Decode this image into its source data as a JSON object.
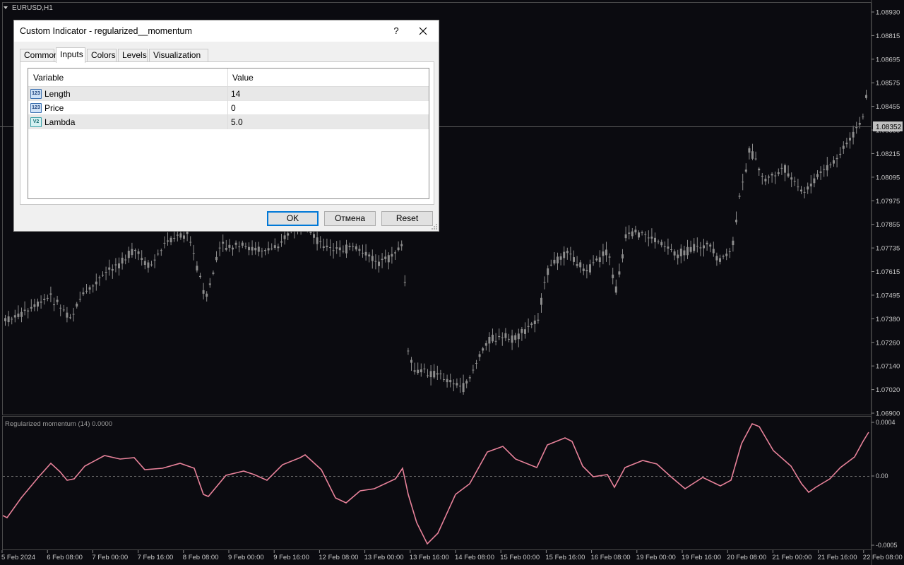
{
  "chart": {
    "symbol": "EURUSD,H1",
    "price_scale": [
      "1.08930",
      "1.08815",
      "1.08695",
      "1.08575",
      "1.08455",
      "1.08335",
      "1.08215",
      "1.08095",
      "1.07975",
      "1.07855",
      "1.07735",
      "1.07615",
      "1.07495",
      "1.07380",
      "1.07260",
      "1.07140",
      "1.07020",
      "1.06900"
    ],
    "current_price": "1.08352",
    "colors": {
      "background": "#0b0b10",
      "candles": "#8c8c8c",
      "indicator_line": "#e8829a",
      "price_tag": "#c0c0c0"
    }
  },
  "indicator": {
    "label": "Regularized momentum (14) 0.0000",
    "scale": [
      "0.0004",
      "0.00",
      "-0.0005"
    ],
    "levels": [
      0.0004,
      0.0,
      -0.0005
    ]
  },
  "time_axis": [
    "5 Feb 2024",
    "6 Feb 08:00",
    "7 Feb 00:00",
    "7 Feb 16:00",
    "8 Feb 08:00",
    "9 Feb 00:00",
    "9 Feb 16:00",
    "12 Feb 08:00",
    "13 Feb 00:00",
    "13 Feb 16:00",
    "14 Feb 08:00",
    "15 Feb 00:00",
    "15 Feb 16:00",
    "16 Feb 08:00",
    "19 Feb 00:00",
    "19 Feb 16:00",
    "20 Feb 08:00",
    "21 Feb 00:00",
    "21 Feb 16:00",
    "22 Feb 08:00"
  ],
  "dialog": {
    "title": "Custom Indicator - regularized__momentum",
    "help": "?",
    "tabs": [
      "Common",
      "Inputs",
      "Colors",
      "Levels",
      "Visualization"
    ],
    "active_tab": "Inputs",
    "columns": {
      "variable": "Variable",
      "value": "Value"
    },
    "rows": [
      {
        "icon": "int-param-icon",
        "icon_text": "123",
        "variable": "Length",
        "value": "14"
      },
      {
        "icon": "int-param-icon",
        "icon_text": "123",
        "variable": "Price",
        "value": "0"
      },
      {
        "icon": "double-param-icon",
        "icon_text": "V2",
        "variable": "Lambda",
        "value": "5.0"
      }
    ],
    "buttons": {
      "ok": "OK",
      "cancel": "Отмена",
      "reset": "Reset"
    }
  }
}
